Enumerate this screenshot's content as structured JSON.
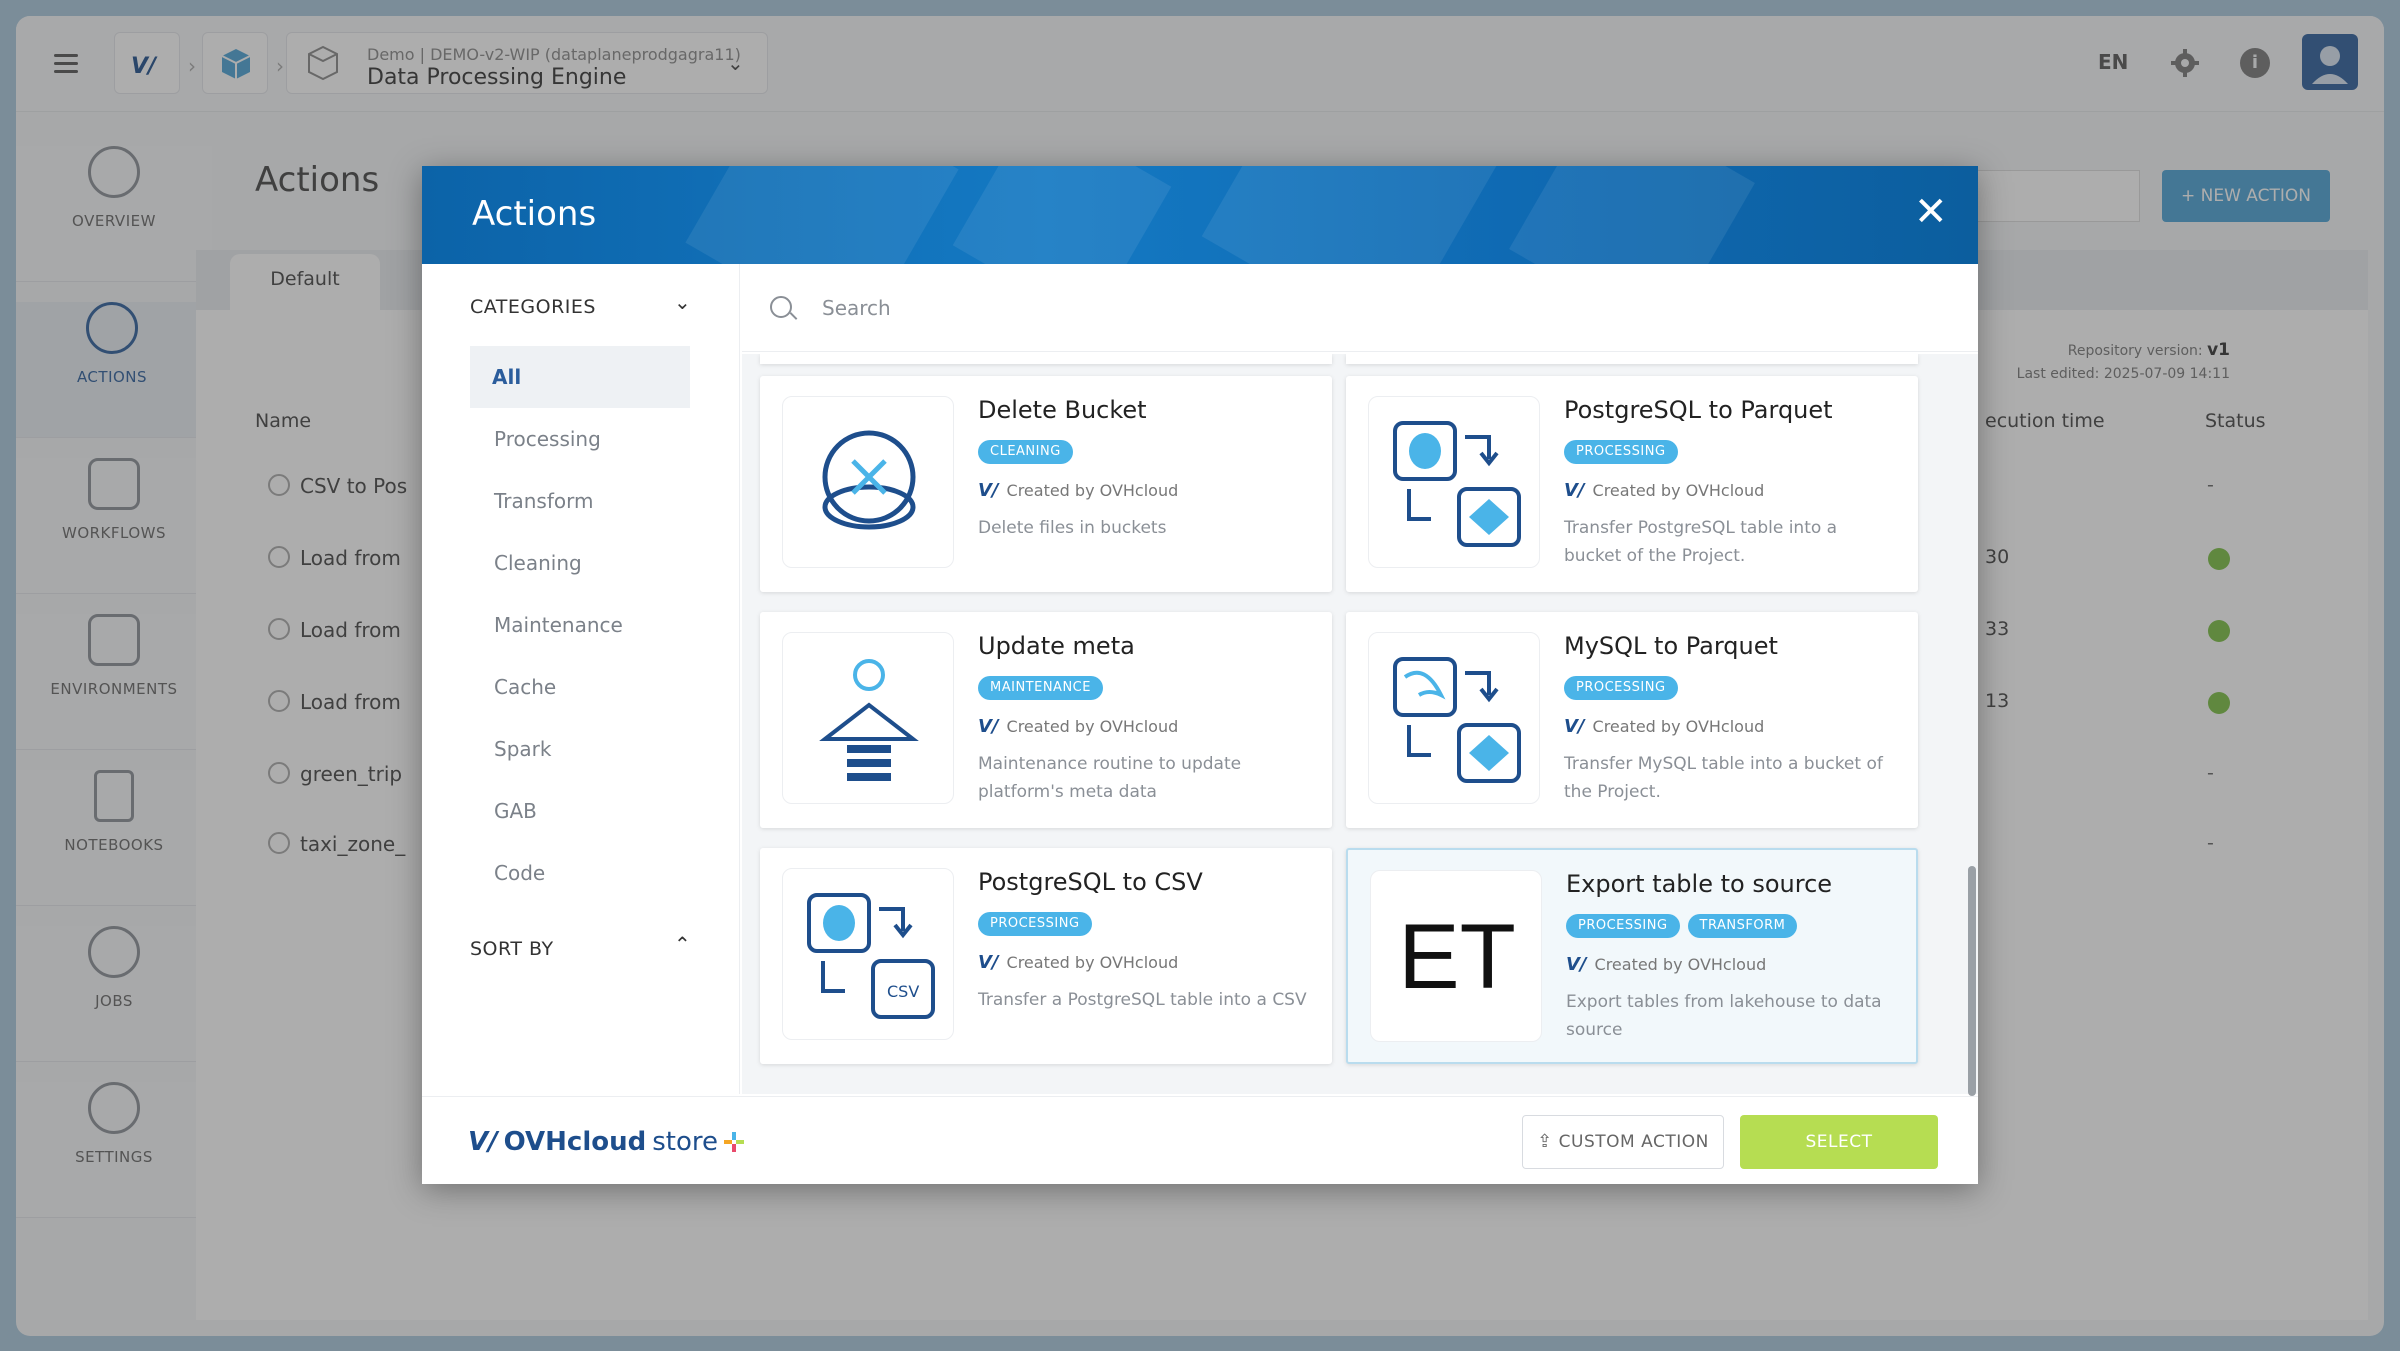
{
  "breadcrumb": {
    "path_small": "Demo | DEMO-v2-WIP (dataplaneprodgagra11)",
    "title": "Data Processing Engine"
  },
  "topbar": {
    "lang": "EN"
  },
  "sidebar": {
    "items": [
      {
        "label": "OVERVIEW"
      },
      {
        "label": "ACTIONS"
      },
      {
        "label": "WORKFLOWS"
      },
      {
        "label": "ENVIRONMENTS"
      },
      {
        "label": "NOTEBOOKS"
      },
      {
        "label": "JOBS"
      },
      {
        "label": "SETTINGS"
      }
    ]
  },
  "main": {
    "title": "Actions",
    "tab": "Default",
    "new_action": "+ NEW ACTION",
    "repo_version_label": "Repository version:",
    "repo_version": "v1",
    "last_edited": "Last edited: 2025-07-09 14:11",
    "col_name": "Name",
    "col_exec": "ecution time",
    "col_status": "Status",
    "rows": [
      {
        "name": "CSV to Pos",
        "exec": "",
        "status": "-"
      },
      {
        "name": "Load from",
        "exec": "30",
        "status": "ok"
      },
      {
        "name": "Load from",
        "exec": "33",
        "status": "ok"
      },
      {
        "name": "Load from",
        "exec": "13",
        "status": "ok"
      },
      {
        "name": "green_trip",
        "exec": "",
        "status": "-"
      },
      {
        "name": "taxi_zone_",
        "exec": "",
        "status": "-"
      }
    ]
  },
  "modal": {
    "title": "Actions",
    "close": "✕",
    "categories_label": "CATEGORIES",
    "categories": [
      "All",
      "Processing",
      "Transform",
      "Cleaning",
      "Maintenance",
      "Cache",
      "Spark",
      "GAB",
      "Code"
    ],
    "sort_label": "SORT BY",
    "search_placeholder": "Search",
    "cards": [
      {
        "title": "Delete Bucket",
        "badges": [
          "CLEANING"
        ],
        "author": "Created by OVHcloud",
        "desc": "Delete files in buckets"
      },
      {
        "title": "PostgreSQL to Parquet",
        "badges": [
          "PROCESSING"
        ],
        "author": "Created by OVHcloud",
        "desc": "Transfer PostgreSQL table into a bucket of the Project."
      },
      {
        "title": "Update meta",
        "badges": [
          "MAINTENANCE"
        ],
        "author": "Created by OVHcloud",
        "desc": "Maintenance routine to update platform's meta data"
      },
      {
        "title": "MySQL to Parquet",
        "badges": [
          "PROCESSING"
        ],
        "author": "Created by OVHcloud",
        "desc": "Transfer MySQL table into a bucket of the Project."
      },
      {
        "title": "PostgreSQL to CSV",
        "badges": [
          "PROCESSING"
        ],
        "author": "Created by OVHcloud",
        "desc": "Transfer a PostgreSQL table into a CSV"
      },
      {
        "title": "Export table to source",
        "badges": [
          "PROCESSING",
          "TRANSFORM"
        ],
        "author": "Created by OVHcloud",
        "desc": "Export tables from lakehouse to data source",
        "thumb_text": "ET"
      }
    ],
    "footer": {
      "store_brand": "OVHcloud",
      "store_word": "store",
      "custom_action": "CUSTOM ACTION",
      "select": "SELECT"
    }
  },
  "colors": {
    "accent": "#2b5d9c",
    "badge": "#4ab4e8",
    "select": "#b6dd52",
    "ok": "#7ac043"
  }
}
